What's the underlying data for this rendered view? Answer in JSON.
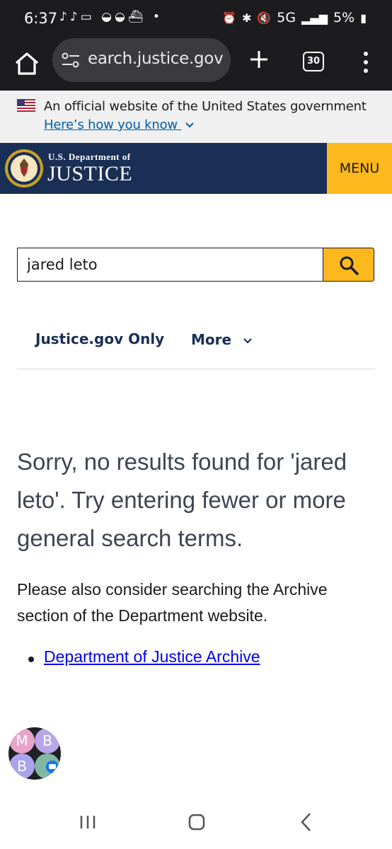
{
  "status_bar": {
    "time": "6:37",
    "notification_icons": "♪♪▭ ◒◒⛴ •",
    "network": "5G",
    "battery": "5%"
  },
  "browser": {
    "url": "earch.justice.gov",
    "tab_count": "30"
  },
  "gov_banner": {
    "text": "An official website of the United States government",
    "link": "Here’s how you know"
  },
  "header": {
    "dept_small": "U.S. Department of",
    "dept_big": "JUSTICE",
    "menu_label": "MENU"
  },
  "search": {
    "query": "jared leto"
  },
  "filters": {
    "justice_only": "Justice.gov Only",
    "more": "More"
  },
  "results": {
    "message": "Sorry, no results found for 'jared leto'. Try entering fewer or more general search terms.",
    "archive_note": "Please also consider searching the Archive section of the Department website.",
    "archive_link": "Department of Justice Archive"
  },
  "chat_bubbles": {
    "initials": [
      "M",
      "B",
      "B"
    ]
  },
  "colors": {
    "header_navy": "#1a2f55",
    "accent_gold": "#fdb81e",
    "gov_link_blue": "#005ea2"
  }
}
